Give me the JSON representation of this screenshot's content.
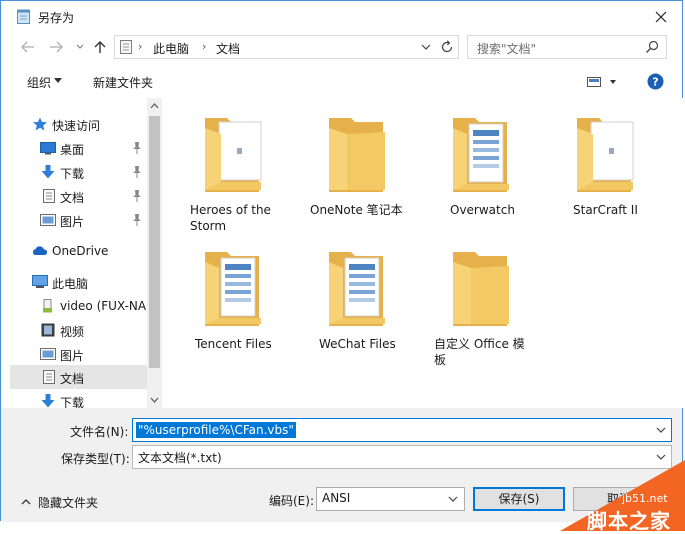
{
  "window": {
    "title": "另存为"
  },
  "address": {
    "segments": [
      "此电脑",
      "文档"
    ]
  },
  "search": {
    "placeholder": "搜索\"文档\""
  },
  "toolbar": {
    "organize": "组织",
    "new_folder": "新建文件夹"
  },
  "sidebar": {
    "items": [
      {
        "label": "快速访问",
        "icon": "star-icon"
      },
      {
        "label": "桌面",
        "icon": "desktop-icon",
        "pinned": true
      },
      {
        "label": "下载",
        "icon": "download-icon",
        "pinned": true
      },
      {
        "label": "文档",
        "icon": "document-icon",
        "pinned": true
      },
      {
        "label": "图片",
        "icon": "picture-icon",
        "pinned": true
      },
      {
        "label": "OneDrive",
        "icon": "cloud-icon"
      },
      {
        "label": "此电脑",
        "icon": "computer-icon"
      },
      {
        "label": "video (FUX-NA",
        "icon": "drive-icon"
      },
      {
        "label": "视频",
        "icon": "video-icon"
      },
      {
        "label": "图片",
        "icon": "picture-icon"
      },
      {
        "label": "文档",
        "icon": "document-icon",
        "selected": true
      },
      {
        "label": "下载",
        "icon": "download-icon"
      }
    ]
  },
  "folders": [
    {
      "name": "Heroes of the Storm",
      "icon": "folder-doc-icon"
    },
    {
      "name": "OneNote 笔记本",
      "icon": "folder-icon"
    },
    {
      "name": "Overwatch",
      "icon": "folder-files-icon"
    },
    {
      "name": "StarCraft II",
      "icon": "folder-doc-icon"
    },
    {
      "name": "Tencent Files",
      "icon": "folder-files-icon"
    },
    {
      "name": "WeChat Files",
      "icon": "folder-files-icon"
    },
    {
      "name": "自定义 Office 模板",
      "icon": "folder-icon"
    }
  ],
  "form": {
    "filename_label": "文件名(N):",
    "filename_value": "\"%userprofile%\\CFan.vbs\"",
    "type_label": "保存类型(T):",
    "type_value": "文本文档(*.txt)",
    "hide_folders": "隐藏文件夹",
    "encoding_label": "编码(E):",
    "encoding_value": "ANSI",
    "save": "保存(S)",
    "cancel": "取消"
  },
  "watermark": {
    "url": "jb51.net",
    "name": "脚本之家"
  },
  "colors": {
    "accent": "#0078d7",
    "folder": "#f7d377",
    "watermark": "#f26522"
  }
}
